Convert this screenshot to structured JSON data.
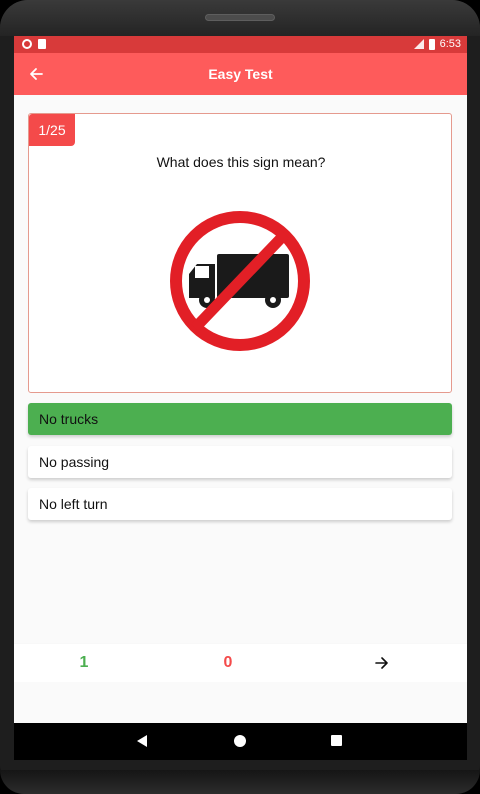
{
  "status_bar": {
    "time": "6:53"
  },
  "app_bar": {
    "back_icon": "arrow-left-icon",
    "title": "Easy Test"
  },
  "question": {
    "counter": "1/25",
    "text": "What does this sign mean?",
    "image": "no-trucks-sign"
  },
  "answers": [
    {
      "label": "No trucks",
      "state": "correct",
      "color": "#4caf50"
    },
    {
      "label": "No passing",
      "state": "default"
    },
    {
      "label": "No left turn",
      "state": "default"
    }
  ],
  "score": {
    "correct": "1",
    "wrong": "0",
    "next_icon": "arrow-right-icon"
  },
  "colors": {
    "status_bar": "#d83a3a",
    "app_bar": "#fe5b5b",
    "badge": "#f44a4a",
    "correct": "#4caf50",
    "wrong": "#f44a4a"
  }
}
